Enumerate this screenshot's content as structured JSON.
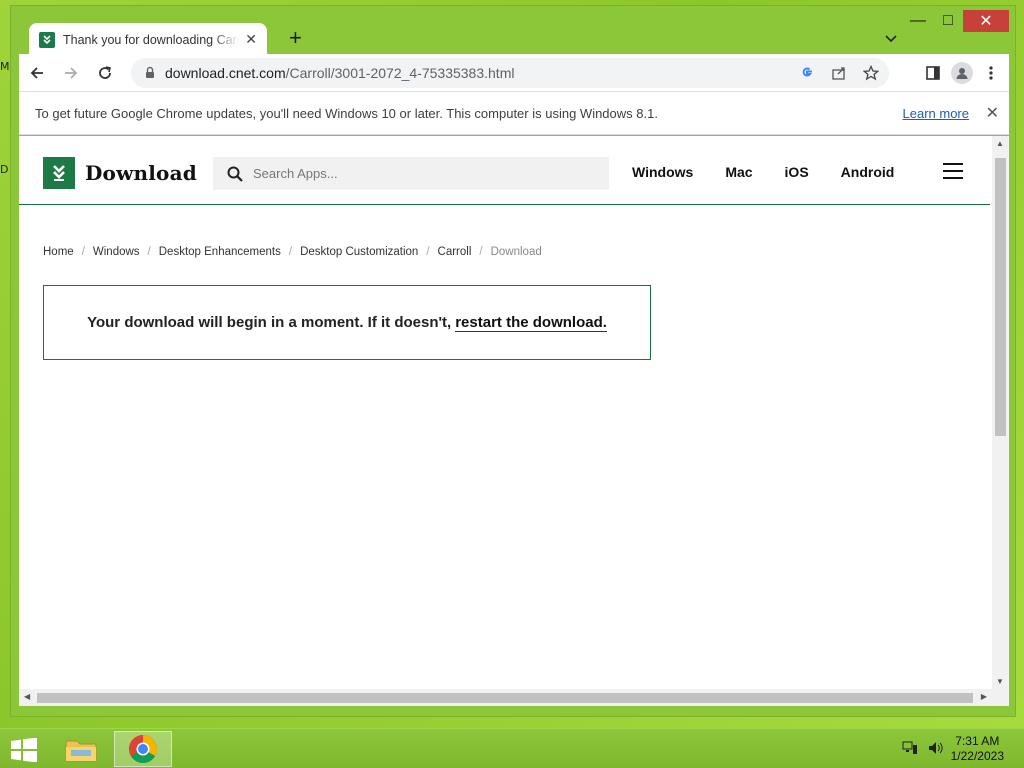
{
  "desktop": {
    "fragments": [
      "M",
      "D"
    ]
  },
  "window": {
    "minimize": "—",
    "maximize": "□",
    "close": "✕"
  },
  "tab": {
    "title": "Thank you for downloading Carroll",
    "close": "✕",
    "new_tab": "+"
  },
  "toolbar": {
    "url_host": "download.cnet.com",
    "url_path": "/Carroll/3001-2072_4-75335383.html"
  },
  "infobar": {
    "message": "To get future Google Chrome updates, you'll need Windows 10 or later. This computer is using Windows 8.1.",
    "link": "Learn more",
    "close": "✕"
  },
  "site": {
    "logo_text": "Download",
    "search_placeholder": "Search Apps...",
    "nav": [
      "Windows",
      "Mac",
      "iOS",
      "Android"
    ]
  },
  "breadcrumb": [
    "Home",
    "Windows",
    "Desktop Enhancements",
    "Desktop Customization",
    "Carroll",
    "Download"
  ],
  "download_box": {
    "message": "Your download will begin in a moment. If it doesn't,",
    "link": "restart the download."
  },
  "taskbar": {
    "time": "7:31 AM",
    "date": "1/22/2023"
  }
}
